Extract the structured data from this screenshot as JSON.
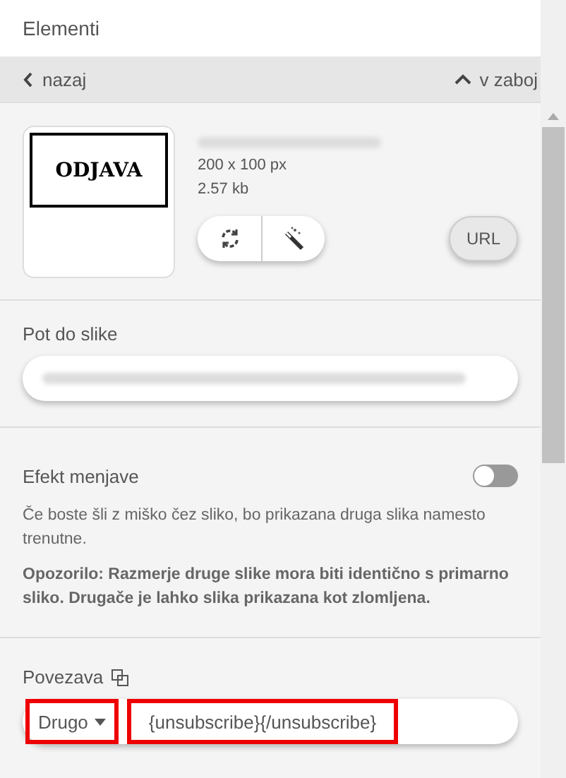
{
  "panel": {
    "title": "Elementi"
  },
  "nav": {
    "back": "nazaj",
    "up": "v zaboj"
  },
  "image": {
    "logo_text": "ODJAVA",
    "dimensions": "200 x 100 px",
    "size": "2.57 kb",
    "url_button": "URL"
  },
  "path": {
    "label": "Pot do slike"
  },
  "swap": {
    "label": "Efekt menjave",
    "on": false,
    "description": "Če boste šli z miško čez sliko, bo prikazana druga slika namesto trenutne.",
    "warning": "Opozorilo: Razmerje druge slike mora biti identično s primarno sliko. Drugače je lahko slika prikazana kot zlomljena."
  },
  "link": {
    "label": "Povezava",
    "type": "Drugo",
    "type_highlighted": true,
    "value": "{unsubscribe}{/unsubscribe}",
    "value_highlighted": true
  }
}
